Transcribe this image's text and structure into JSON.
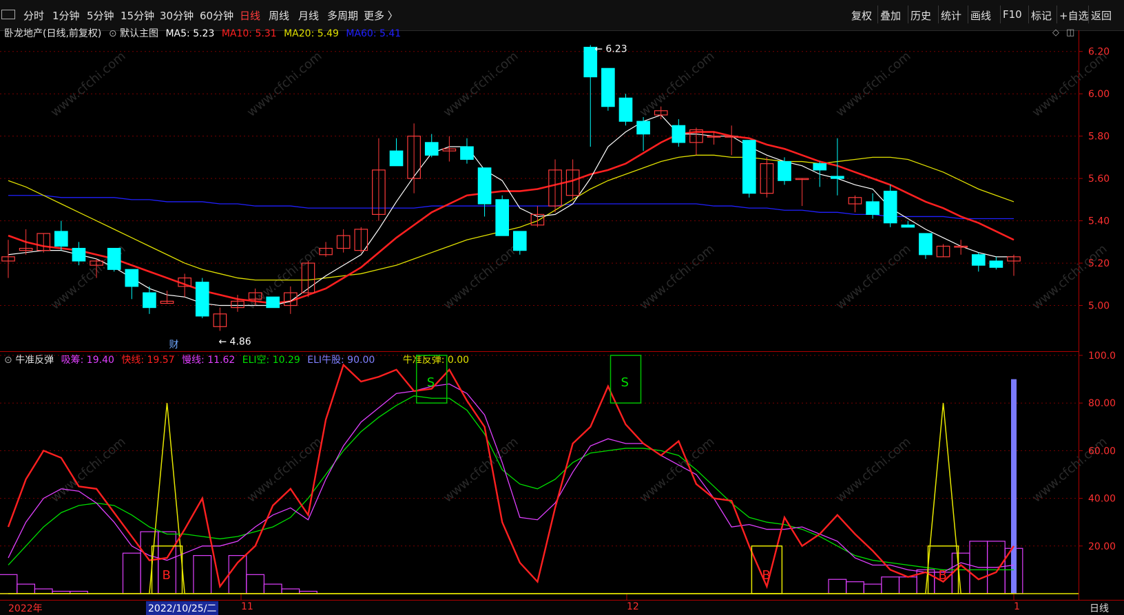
{
  "toolbar": {
    "left_items": [
      "分时",
      "1分钟",
      "5分钟",
      "15分钟",
      "30分钟",
      "60分钟",
      "日线",
      "周线",
      "月线",
      "多周期",
      "更多 〉"
    ],
    "active": "日线",
    "right_items": [
      "复权",
      "叠加",
      "历史",
      "统计",
      "画线",
      "F10",
      "标记",
      "+自选",
      "返回"
    ]
  },
  "main_legend": {
    "stock": "卧龙地产(日线,前复权)",
    "template": "默认主图",
    "ma5": "MA5: 5.23",
    "ma10": "MA10: 5.31",
    "ma20": "MA20: 5.49",
    "ma60": "MA60: 5.41"
  },
  "sub_legend": {
    "name": "牛准反弹",
    "xichou": "吸筹: 19.40",
    "kuaixian": "快线: 19.57",
    "manxian": "慢线: 11.62",
    "eli_kong": "ELI空: 10.29",
    "eli_niu": "ELI牛股: 90.00",
    "fantan": "牛准反弹: 0.00"
  },
  "annotations": {
    "high": "6.23",
    "low": "4.86",
    "cai": "财",
    "b": "B",
    "s": "S"
  },
  "price_axis": [
    "6.20",
    "6.00",
    "5.80",
    "5.60",
    "5.40",
    "5.20",
    "5.00"
  ],
  "indicator_axis": [
    "100.0",
    "80.00",
    "60.00",
    "40.00",
    "20.00"
  ],
  "date_axis": {
    "start": "2022年",
    "cursor": "2022/10/25/二",
    "m11": "11",
    "m12": "12",
    "m1": "1",
    "period": "日线"
  },
  "watermark": "www.cfchi.com",
  "colors": {
    "up": "#ff3b3b",
    "down": "#00ffff",
    "ma5": "#ffffff",
    "ma10": "#ff2020",
    "ma20": "#e0e000",
    "ma60": "#2020ff",
    "axis": "#ff3030",
    "xichou": "#e040ff",
    "kuaixian": "#ff2020",
    "manxian": "#00e000"
  },
  "chart_data": {
    "type": "candlestick",
    "price_range": [
      4.8,
      6.3
    ],
    "indicator_range": [
      0,
      100
    ],
    "candles": [
      [
        5.21,
        5.23,
        5.13,
        5.31
      ],
      [
        5.26,
        5.27,
        5.24,
        5.36
      ],
      [
        5.26,
        5.34,
        5.25,
        5.34
      ],
      [
        5.35,
        5.28,
        5.26,
        5.4
      ],
      [
        5.27,
        5.21,
        5.19,
        5.3
      ],
      [
        5.19,
        5.21,
        5.13,
        5.22
      ],
      [
        5.27,
        5.17,
        5.16,
        5.27
      ],
      [
        5.17,
        5.09,
        5.03,
        5.17
      ],
      [
        5.06,
        4.99,
        4.96,
        5.09
      ],
      [
        5.01,
        5.02,
        5.01,
        5.07
      ],
      [
        5.09,
        5.13,
        5.04,
        5.15
      ],
      [
        5.11,
        4.95,
        4.94,
        5.13
      ],
      [
        4.9,
        4.96,
        4.88,
        4.99
      ],
      [
        4.99,
        5.02,
        4.97,
        5.05
      ],
      [
        5.03,
        5.06,
        5.0,
        5.08
      ],
      [
        5.04,
        4.99,
        4.99,
        5.04
      ],
      [
        5.0,
        5.06,
        4.96,
        5.09
      ],
      [
        5.06,
        5.2,
        5.04,
        5.21
      ],
      [
        5.24,
        5.27,
        5.23,
        5.3
      ],
      [
        5.27,
        5.33,
        5.25,
        5.36
      ],
      [
        5.26,
        5.36,
        5.25,
        5.37
      ],
      [
        5.43,
        5.64,
        5.4,
        5.79
      ],
      [
        5.73,
        5.66,
        5.66,
        5.79
      ],
      [
        5.6,
        5.8,
        5.53,
        5.86
      ],
      [
        5.77,
        5.71,
        5.7,
        5.81
      ],
      [
        5.73,
        5.74,
        5.68,
        5.8
      ],
      [
        5.75,
        5.69,
        5.67,
        5.79
      ],
      [
        5.65,
        5.48,
        5.42,
        5.65
      ],
      [
        5.5,
        5.33,
        5.33,
        5.52
      ],
      [
        5.35,
        5.26,
        5.24,
        5.35
      ],
      [
        5.38,
        5.43,
        5.37,
        5.47
      ],
      [
        5.47,
        5.64,
        5.44,
        5.69
      ],
      [
        5.52,
        5.64,
        5.5,
        5.69
      ],
      [
        6.22,
        6.08,
        5.75,
        6.23
      ],
      [
        6.12,
        5.94,
        5.92,
        6.12
      ],
      [
        5.98,
        5.87,
        5.85,
        6.0
      ],
      [
        5.87,
        5.81,
        5.73,
        5.89
      ],
      [
        5.9,
        5.92,
        5.88,
        5.94
      ],
      [
        5.85,
        5.77,
        5.75,
        5.88
      ],
      [
        5.77,
        5.83,
        5.71,
        5.84
      ],
      [
        5.8,
        5.8,
        5.76,
        5.82
      ],
      [
        5.8,
        5.8,
        5.71,
        5.85
      ],
      [
        5.78,
        5.53,
        5.51,
        5.78
      ],
      [
        5.53,
        5.67,
        5.51,
        5.7
      ],
      [
        5.68,
        5.59,
        5.57,
        5.7
      ],
      [
        5.6,
        5.6,
        5.47,
        5.6
      ],
      [
        5.67,
        5.64,
        5.56,
        5.68
      ],
      [
        5.61,
        5.6,
        5.52,
        5.79
      ],
      [
        5.48,
        5.51,
        5.44,
        5.52
      ],
      [
        5.49,
        5.43,
        5.41,
        5.53
      ],
      [
        5.54,
        5.39,
        5.37,
        5.57
      ],
      [
        5.38,
        5.37,
        5.37,
        5.4
      ],
      [
        5.34,
        5.24,
        5.22,
        5.34
      ],
      [
        5.23,
        5.28,
        5.23,
        5.29
      ],
      [
        5.28,
        5.28,
        5.24,
        5.31
      ],
      [
        5.24,
        5.19,
        5.16,
        5.25
      ],
      [
        5.21,
        5.18,
        5.17,
        5.23
      ],
      [
        5.21,
        5.23,
        5.14,
        5.24
      ]
    ],
    "ma5": [
      5.24,
      5.25,
      5.26,
      5.26,
      5.24,
      5.22,
      5.18,
      5.13,
      5.08,
      5.05,
      5.04,
      5.01,
      5.0,
      5.0,
      5.0,
      5.0,
      5.02,
      5.08,
      5.14,
      5.19,
      5.24,
      5.36,
      5.49,
      5.61,
      5.72,
      5.75,
      5.75,
      5.64,
      5.59,
      5.46,
      5.42,
      5.43,
      5.48,
      5.6,
      5.75,
      5.82,
      5.87,
      5.9,
      5.81,
      5.81,
      5.8,
      5.8,
      5.75,
      5.71,
      5.68,
      5.66,
      5.62,
      5.6,
      5.57,
      5.55,
      5.46,
      5.41,
      5.36,
      5.32,
      5.28,
      5.25,
      5.23,
      5.23
    ],
    "ma10": [
      5.33,
      5.3,
      5.28,
      5.27,
      5.26,
      5.24,
      5.22,
      5.19,
      5.16,
      5.13,
      5.1,
      5.07,
      5.05,
      5.03,
      5.02,
      5.01,
      5.02,
      5.05,
      5.08,
      5.13,
      5.18,
      5.25,
      5.32,
      5.38,
      5.44,
      5.48,
      5.52,
      5.53,
      5.54,
      5.54,
      5.55,
      5.57,
      5.59,
      5.62,
      5.64,
      5.67,
      5.72,
      5.77,
      5.81,
      5.82,
      5.82,
      5.8,
      5.79,
      5.76,
      5.74,
      5.71,
      5.68,
      5.66,
      5.63,
      5.6,
      5.57,
      5.53,
      5.49,
      5.46,
      5.42,
      5.39,
      5.35,
      5.31
    ],
    "ma20": [
      5.59,
      5.56,
      5.52,
      5.48,
      5.44,
      5.4,
      5.36,
      5.32,
      5.28,
      5.24,
      5.2,
      5.17,
      5.15,
      5.13,
      5.12,
      5.12,
      5.12,
      5.12,
      5.13,
      5.14,
      5.15,
      5.17,
      5.19,
      5.22,
      5.25,
      5.28,
      5.31,
      5.33,
      5.35,
      5.37,
      5.4,
      5.45,
      5.5,
      5.55,
      5.59,
      5.62,
      5.65,
      5.68,
      5.7,
      5.71,
      5.71,
      5.7,
      5.7,
      5.69,
      5.68,
      5.68,
      5.67,
      5.68,
      5.69,
      5.7,
      5.7,
      5.69,
      5.66,
      5.63,
      5.59,
      5.55,
      5.52,
      5.49
    ],
    "ma60": [
      5.52,
      5.52,
      5.52,
      5.51,
      5.51,
      5.51,
      5.51,
      5.5,
      5.5,
      5.49,
      5.49,
      5.49,
      5.48,
      5.48,
      5.47,
      5.47,
      5.47,
      5.46,
      5.46,
      5.46,
      5.46,
      5.46,
      5.46,
      5.46,
      5.47,
      5.47,
      5.47,
      5.47,
      5.47,
      5.47,
      5.47,
      5.47,
      5.48,
      5.48,
      5.48,
      5.48,
      5.48,
      5.48,
      5.48,
      5.48,
      5.47,
      5.47,
      5.46,
      5.46,
      5.45,
      5.45,
      5.44,
      5.44,
      5.43,
      5.43,
      5.42,
      5.42,
      5.42,
      5.42,
      5.41,
      5.41,
      5.41,
      5.41
    ],
    "kuaixian": [
      28,
      48,
      60,
      57,
      45,
      44,
      34,
      24,
      14,
      15,
      27,
      40,
      3,
      13,
      20,
      37,
      44,
      33,
      73,
      96,
      89,
      91,
      94,
      85,
      86,
      94,
      81,
      70,
      30,
      13,
      5,
      36,
      63,
      70,
      87,
      71,
      63,
      58,
      64,
      46,
      40,
      39,
      20,
      3,
      32,
      20,
      25,
      33,
      25,
      18,
      10,
      7,
      9,
      5,
      12,
      6,
      9,
      20
    ],
    "manxian": [
      15,
      30,
      40,
      44,
      43,
      38,
      30,
      20,
      16,
      14,
      17,
      20,
      20,
      22,
      28,
      33,
      36,
      31,
      48,
      62,
      72,
      78,
      84,
      85,
      87,
      88,
      84,
      75,
      55,
      32,
      31,
      38,
      51,
      62,
      65,
      63,
      63,
      58,
      54,
      50,
      40,
      28,
      29,
      27,
      27,
      28,
      25,
      22,
      15,
      12,
      12,
      10,
      9,
      9,
      13,
      11,
      11,
      12
    ],
    "eli_kong": [
      12,
      20,
      28,
      34,
      37,
      38,
      37,
      33,
      28,
      25,
      25,
      24,
      23,
      24,
      26,
      28,
      32,
      40,
      50,
      60,
      68,
      74,
      79,
      83,
      82,
      82,
      77,
      67,
      52,
      46,
      44,
      48,
      55,
      59,
      60,
      61,
      61,
      60,
      58,
      52,
      45,
      38,
      32,
      30,
      29,
      27,
      24,
      20,
      16,
      14,
      13,
      12,
      11,
      10,
      10,
      10,
      10,
      10
    ],
    "xichou": [
      8,
      4,
      2,
      1,
      1,
      0,
      0,
      17,
      26,
      26,
      0,
      16,
      0,
      16,
      8,
      4,
      2,
      1,
      0,
      0,
      0,
      0,
      0,
      0,
      0,
      0,
      0,
      0,
      0,
      0,
      0,
      0,
      0,
      0,
      0,
      0,
      0,
      0,
      0,
      0,
      0,
      0,
      0,
      0,
      0,
      0,
      0,
      6,
      5,
      4,
      7,
      7,
      10,
      9,
      17,
      22,
      22,
      19
    ],
    "b_signals": [
      9,
      43,
      53
    ],
    "s_signals": [
      24,
      35
    ],
    "eli_niu_index": 57,
    "eli_niu_value": 90
  }
}
